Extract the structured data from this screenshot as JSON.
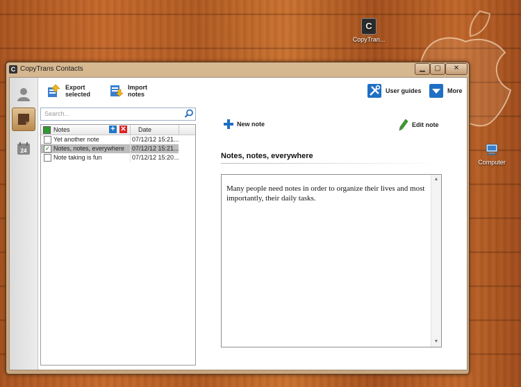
{
  "desktop": {
    "icons": [
      {
        "label": "CopyTran..."
      },
      {
        "label": "Computer"
      }
    ]
  },
  "window": {
    "title": "CopyTrans Contacts",
    "controls": {
      "minimize": "▁",
      "maximize": "▢",
      "close": "✕"
    }
  },
  "toolbar": {
    "export_line1": "Export",
    "export_line2": "selected",
    "import_line1": "Import",
    "import_line2": "notes",
    "guides_label": "User guides",
    "more_label": "More"
  },
  "nav": {
    "calendar_day": "24"
  },
  "search": {
    "placeholder": "Search..."
  },
  "notes_list": {
    "col_notes": "Notes",
    "col_date": "Date",
    "rows": [
      {
        "title": "Yet another note",
        "date": "07/12/12 15:21...",
        "checked": false,
        "selected": false
      },
      {
        "title": "Notes, notes, everywhere",
        "date": "07/12/12 15:21...",
        "checked": true,
        "selected": true
      },
      {
        "title": "Note taking is fun",
        "date": "07/12/12 15:20...",
        "checked": false,
        "selected": false
      }
    ]
  },
  "editor": {
    "new_note_label": "New note",
    "edit_note_label": "Edit note",
    "note_title": "Notes, notes, everywhere",
    "note_body": "Many people need notes in order to organize their lives and most importantly, their daily tasks."
  },
  "colors": {
    "accent_blue": "#1f6fc4",
    "selection_gray": "#bdbdbd",
    "window_frame": "#c8a67e"
  }
}
